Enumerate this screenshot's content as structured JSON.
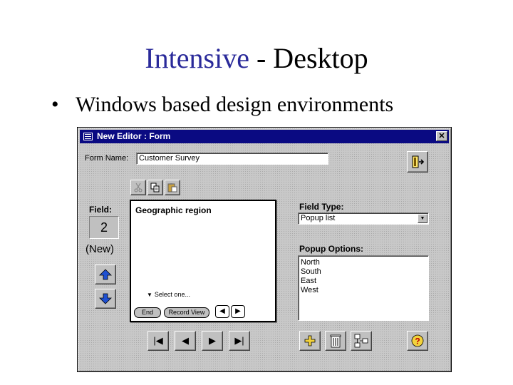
{
  "slide": {
    "title_accent": "Intensive",
    "title_rest": " - Desktop",
    "bullet_glyph": "•",
    "bullet_text": "Windows based design environments"
  },
  "window": {
    "title": "New Editor : Form",
    "close_glyph": "✕"
  },
  "form": {
    "name_label": "Form Name:",
    "name_value": "Customer Survey"
  },
  "field": {
    "label": "Field:",
    "number": "2",
    "state": "(New)"
  },
  "preview": {
    "title": "Geographic region",
    "dropdown_glyph": "▼",
    "dropdown_placeholder": "Select one...",
    "end_label": "End",
    "record_view_label": "Record View",
    "prev_glyph": "◀",
    "next_glyph": "▶"
  },
  "field_type": {
    "label": "Field Type:",
    "value": "Popup list",
    "arrow_glyph": "▼"
  },
  "popup_options": {
    "label": "Popup Options:",
    "items": [
      "North",
      "South",
      "East",
      "West"
    ]
  },
  "navigation": {
    "first_glyph": "|◀",
    "prev_glyph": "◀",
    "next_glyph": "▶",
    "last_glyph": "▶|"
  },
  "icons": {
    "exit": "exit-door-icon",
    "cut": "scissors-icon",
    "copy": "copy-icon",
    "paste": "paste-icon",
    "move_up": "arrow-up-icon",
    "move_down": "arrow-down-icon",
    "add": "plus-icon",
    "delete": "trash-icon",
    "structure": "structure-icon",
    "help": "help-icon"
  },
  "colors": {
    "titlebar": "#0a0a82",
    "title_accent": "#2a2a9a",
    "arrow_blue": "#1e50d2",
    "help_yellow": "#f2d23c"
  }
}
